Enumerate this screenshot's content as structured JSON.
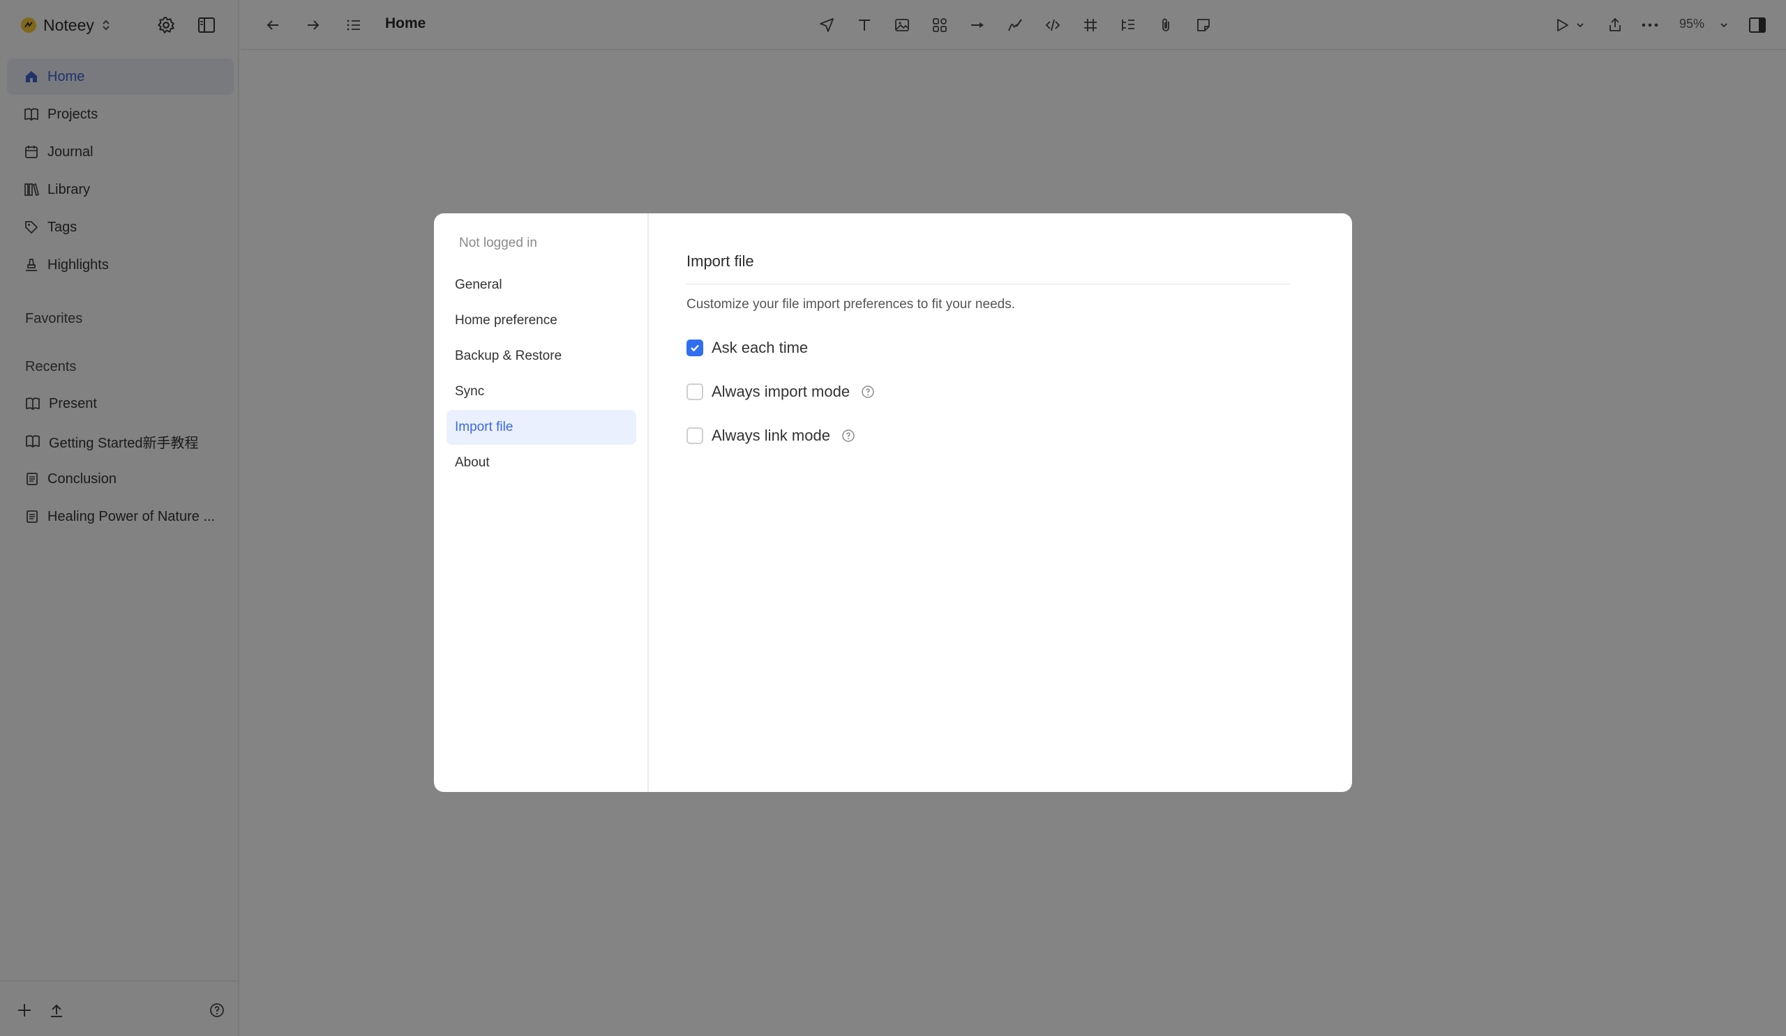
{
  "app": {
    "name": "Noteey"
  },
  "sidebar": {
    "nav": [
      {
        "label": "Home",
        "icon": "home-icon",
        "active": true
      },
      {
        "label": "Projects",
        "icon": "book-icon"
      },
      {
        "label": "Journal",
        "icon": "calendar-icon"
      },
      {
        "label": "Library",
        "icon": "library-icon"
      },
      {
        "label": "Tags",
        "icon": "tag-icon"
      },
      {
        "label": "Highlights",
        "icon": "highlighter-icon"
      }
    ],
    "favorites_label": "Favorites",
    "recents_label": "Recents",
    "recents": [
      {
        "label": "Present",
        "icon": "book-icon"
      },
      {
        "label": "Getting Started新手教程",
        "icon": "book-icon"
      },
      {
        "label": "Conclusion",
        "icon": "document-icon"
      },
      {
        "label": "Healing Power of Nature ...",
        "icon": "document-icon"
      }
    ]
  },
  "topbar": {
    "title": "Home",
    "zoom": "95%"
  },
  "settings": {
    "account_status": "Not logged in",
    "nav": [
      {
        "label": "General"
      },
      {
        "label": "Home preference"
      },
      {
        "label": "Backup & Restore"
      },
      {
        "label": "Sync"
      },
      {
        "label": "Import file",
        "active": true
      },
      {
        "label": "About"
      }
    ],
    "section_title": "Import file",
    "section_description": "Customize your file import preferences to fit your needs.",
    "options": [
      {
        "label": "Ask each time",
        "checked": true,
        "help": false
      },
      {
        "label": "Always import mode",
        "checked": false,
        "help": true
      },
      {
        "label": "Always link mode",
        "checked": false,
        "help": true
      }
    ]
  },
  "colors": {
    "accent": "#3a68e8",
    "checkbox": "#2f6ef2",
    "overlay": "rgba(0,0,0,0.47)"
  }
}
